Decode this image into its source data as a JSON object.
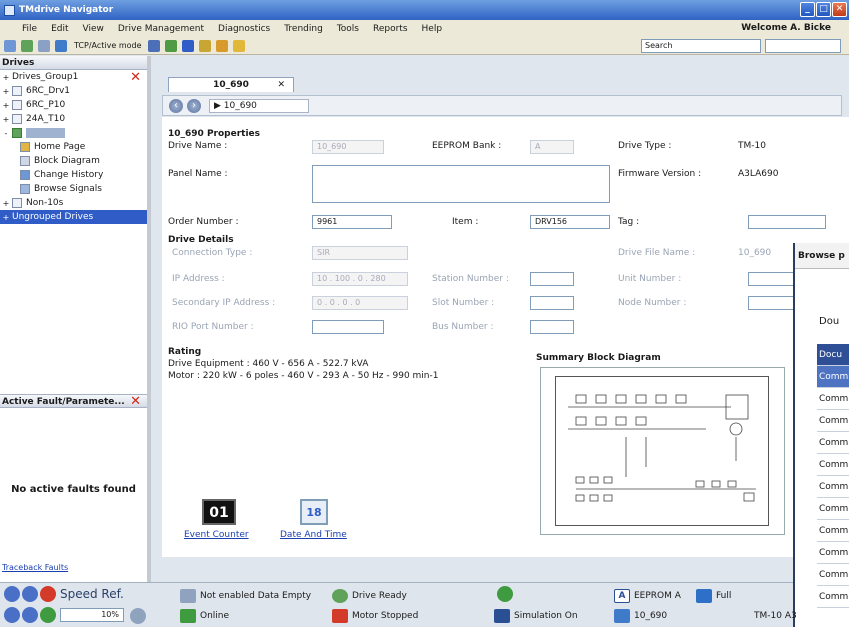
{
  "window": {
    "title": "TMdrive Navigator"
  },
  "menu": [
    "File",
    "Edit",
    "View",
    "Drive Management",
    "Diagnostics",
    "Trending",
    "Tools",
    "Reports",
    "Help"
  ],
  "welcome": "Welcome A. Bicke",
  "toolbar": {
    "mode_text": "TCP/Active mode",
    "search_placeholder": "Search"
  },
  "left_panel": {
    "header": "Drives",
    "items": [
      {
        "label": "Drives_Group1",
        "expander": "+"
      },
      {
        "label": "6RC_Drv1",
        "expander": "+"
      },
      {
        "label": "6RC_P10",
        "expander": "+"
      },
      {
        "label": "24A_T10",
        "expander": "+"
      },
      {
        "label": "10_690",
        "expander": "-"
      },
      {
        "label": "Home Page"
      },
      {
        "label": "Block Diagram"
      },
      {
        "label": "Change History"
      },
      {
        "label": "Browse Signals"
      },
      {
        "label": "Non-10s",
        "expander": "+"
      },
      {
        "label": "Ungrouped Drives",
        "expander": "+"
      }
    ],
    "fault_header": "Active Fault/Paramete...",
    "no_faults": "No active faults found",
    "traceback": "Traceback Faults"
  },
  "tab": {
    "label": "10_690",
    "close": "✕"
  },
  "breadcrumb": "▶ 10_690",
  "props": {
    "heading": "10_690 Properties",
    "drive_name_label": "Drive Name :",
    "drive_name_value": "10_690",
    "eeprom_label": "EEPROM Bank :",
    "eeprom_value": "A",
    "drive_type_label": "Drive Type :",
    "drive_type_value": "TM-10",
    "panel_name_label": "Panel Name :",
    "firmware_label": "Firmware Version :",
    "firmware_value": "A3LA690",
    "order_label": "Order Number :",
    "order_value": "9961",
    "item_label": "Item :",
    "item_value": "DRV156",
    "tag_label": "Tag :",
    "details_heading": "Drive Details",
    "conn_type_label": "Connection Type :",
    "conn_type_value": "SIR",
    "drive_file_label": "Drive File Name :",
    "drive_file_value": "10_690",
    "ip_label": "IP Address :",
    "ip_value": "10 . 100 . 0 . 280",
    "station_label": "Station Number :",
    "unit_label": "Unit Number :",
    "sec_ip_label": "Secondary IP Address :",
    "sec_ip_value": "0 . 0 . 0 . 0",
    "slot_label": "Slot Number :",
    "node_label": "Node Number :",
    "rio_label": "RIO Port Number :",
    "bus_label": "Bus Number :",
    "rating_heading": "Rating",
    "drive_equipment": "Drive Equipment :   460 V - 656 A - 522.7 kVA",
    "motor": "Motor :   220 kW - 6 poles - 460 V - 293 A - 50 Hz - 990 min-1",
    "summary_heading": "Summary Block Diagram",
    "event_counter": "Event Counter",
    "event_counter_icon": "01",
    "date_time": "Date And Time",
    "date_time_icon": "18"
  },
  "browse": {
    "title": "Browse p",
    "doc": "Dou",
    "header": "Docu",
    "rows": [
      "Comm",
      "Comm",
      "Comm",
      "Comm",
      "Comm",
      "Comm",
      "Comm",
      "Comm",
      "Comm",
      "Comm",
      "Comm"
    ]
  },
  "status": {
    "speed_ref": "Speed Ref.",
    "speed_value": "10",
    "speed_unit": "%",
    "not_enabled": "Not enabled Data Empty",
    "online": "Online",
    "drive_ready": "Drive Ready",
    "motor_stopped": "Motor Stopped",
    "simulation": "Simulation On",
    "eeprom": "EEPROM A",
    "full": "Full",
    "drive": "10_690",
    "drive_type": "TM-10 A3"
  },
  "colors": {
    "title_bar": "#2f62c4",
    "selection": "#2f5cc6",
    "link": "#1a3fb0",
    "fault_x": "#d0281a"
  }
}
